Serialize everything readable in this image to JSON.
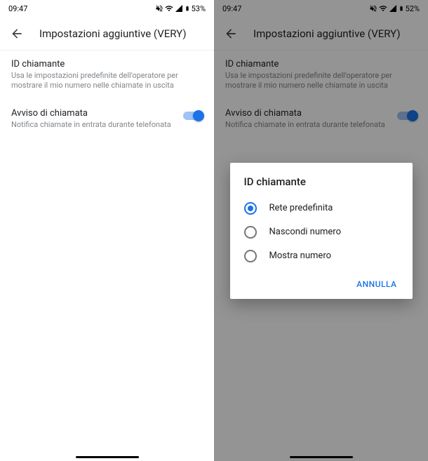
{
  "left": {
    "statusbar": {
      "time": "09:47",
      "battery": "53%"
    },
    "appbar_title": "Impostazioni aggiuntive (VERY)",
    "settings": {
      "caller_id": {
        "title": "ID chiamante",
        "desc": "Usa le impostazioni predefinite dell'operatore per mostrare il mio numero nelle chiamate in uscita"
      },
      "call_waiting": {
        "title": "Avviso di chiamata",
        "desc": "Notifica chiamate in entrata durante telefonata"
      }
    }
  },
  "right": {
    "statusbar": {
      "time": "09:47",
      "battery": "52%"
    },
    "appbar_title": "Impostazioni aggiuntive (VERY)",
    "settings": {
      "caller_id": {
        "title": "ID chiamante",
        "desc": "Usa le impostazioni predefinite dell'operatore per mostrare il mio numero nelle chiamate in uscita"
      },
      "call_waiting": {
        "title": "Avviso di chiamata",
        "desc": "Notifica chiamate in entrata durante telefonata"
      }
    },
    "dialog": {
      "title": "ID chiamante",
      "options": {
        "o0": "Rete predefinita",
        "o1": "Nascondi numero",
        "o2": "Mostra numero"
      },
      "cancel": "ANNULLA"
    }
  }
}
